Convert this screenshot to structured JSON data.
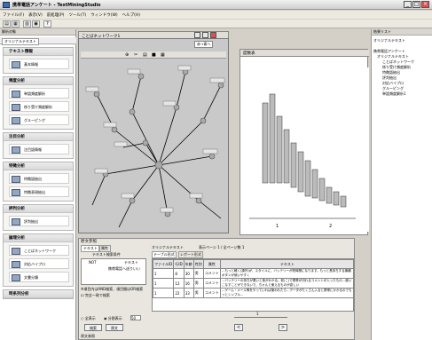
{
  "window": {
    "title": "携帯電話アンケート - TextMiningStudio",
    "min": "_",
    "max": "□",
    "close": "×"
  },
  "menu": [
    "ファイル(F)",
    "表示(V)",
    "前処理(P)",
    "ツール(T)",
    "ウィンドウ(W)",
    "ヘルプ(H)"
  ],
  "toolbar_icons": [
    "open-icon",
    "save-icon",
    "print-icon",
    "table-icon",
    "help-icon"
  ],
  "left": {
    "pane_title": "解析対象",
    "tab_label": "オリジナルテキスト",
    "sections": [
      {
        "title": "テキスト情報",
        "items": [
          "基本情報"
        ]
      },
      {
        "title": "頻度分析",
        "items": [
          "単語頻度解析",
          "係り受け頻度解析",
          "グルーピング"
        ]
      },
      {
        "title": "注目分析",
        "items": [
          "注目語情報"
        ]
      },
      {
        "title": "特徴分析",
        "items": [
          "特徴語抽出",
          "特徴表現抽出"
        ]
      },
      {
        "title": "評判分析",
        "items": [
          "評判抽出"
        ]
      },
      {
        "title": "論理分析",
        "items": [
          "ことばネットワーク",
          "対応バイプロ",
          "文書分類"
        ]
      },
      {
        "title": "時系列分析",
        "items": []
      }
    ]
  },
  "network": {
    "title": "ことばネットワーク1",
    "hint": "赤→青へ"
  },
  "chart": {
    "title": "度数表",
    "axis": [
      "1",
      "2"
    ]
  },
  "bottom": {
    "title": "原文参照",
    "tabs": [
      "テキスト",
      "属性"
    ],
    "subtab": "テキスト検索条件",
    "not_label": "NOT",
    "text_col": "テキスト",
    "cond": "携帯電話へ送りいい",
    "note": "※項目内はAND検索、項目間はOR検索",
    "check": "完全一致で検索",
    "radio1": "全表示",
    "radio2": "分割表示",
    "count": "50",
    "search_btn": "検索",
    "orig_btn": "原文",
    "status": "原文参照",
    "orig_tab": "オリジナルテキスト",
    "page_info": "表示ページ 1 / 全ページ数 1",
    "sub_tabs": [
      "テーブル形式",
      "レポート形式"
    ],
    "columns": [
      "ファイルID",
      "行ID",
      "年齢",
      "性別",
      "属性",
      "テキスト"
    ],
    "rows": [
      {
        "cells": [
          "1",
          "8",
          "30",
          "男",
          "コメント",
          "…もっと軽く(操作)が、スタイルに、バッテリーが短時間になります。もっと長持ちする機種 ボタンが使いやすく"
        ]
      },
      {
        "cells": [
          "1",
          "12",
          "16",
          "男",
          "コメント",
          "…バッテリーの持ちが悪いと音がかかる。前(こ)で携帯が切れるコメントが入ったもの…使いこなすことができないで、ちゃんと使えるものが欲しい"
        ]
      },
      {
        "cells": [
          "1",
          "22",
          "33",
          "男",
          "コメント",
          "…ゲーム・メール等をやっていれば使われたら…データがたくさん入ると携帯にかかるのでもっとシンプル…"
        ]
      }
    ],
    "pager_prev": "<",
    "pager_next": ">",
    "slider_val": "1"
  },
  "right": {
    "title": "結果リスト",
    "tab": "オリジナルテキスト",
    "tree": [
      "携帯電話アンケート",
      "オリジナルテキスト",
      "ことばネットワーク",
      "係り受け頻度解析",
      "特徴語抽出",
      "評判抽出",
      "対応バイプロ",
      "グルーピング",
      "単語頻度解析1"
    ]
  }
}
